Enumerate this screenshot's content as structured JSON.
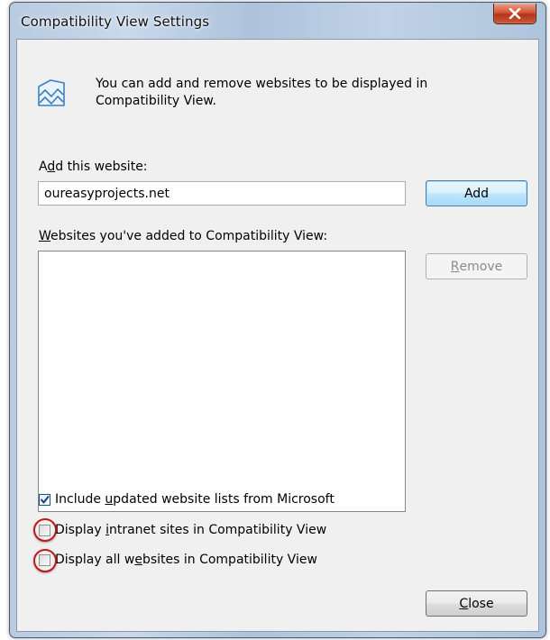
{
  "window": {
    "title": "Compatibility View Settings",
    "close_glyph": "x"
  },
  "info": {
    "icon": "compatibility-view-icon",
    "text": "You can add and remove websites to be displayed in Compatibility View."
  },
  "add_section": {
    "label_pre": "A",
    "label_access": "d",
    "label_post": "d this website:",
    "input_value": "oureasyprojects.net",
    "button_label": "Add"
  },
  "list_section": {
    "label_access": "W",
    "label_post": "ebsites you've added to Compatibility View:",
    "items": [],
    "remove_access": "R",
    "remove_post": "emove"
  },
  "options": [
    {
      "pre": "Include ",
      "access": "u",
      "post": "pdated website lists from Microsoft",
      "checked": true
    },
    {
      "pre": "Display ",
      "access": "i",
      "post": "ntranet sites in Compatibility View",
      "checked": false
    },
    {
      "pre": "Display all w",
      "access": "e",
      "post": "bsites in Compatibility View",
      "checked": false
    }
  ],
  "footer": {
    "close_access": "C",
    "close_post": "lose"
  },
  "colors": {
    "annotation_circle": "#c01818",
    "default_button_border": "#3c7fb1",
    "dialog_background": "#f0f0f0"
  }
}
